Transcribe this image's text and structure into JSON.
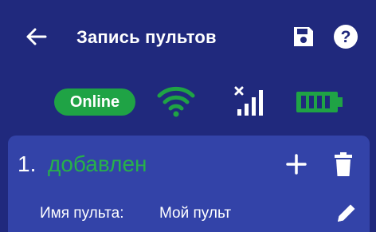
{
  "appbar": {
    "title": "Запись пультов",
    "back_icon": "arrow-left-icon",
    "save_icon": "floppy-disk-icon",
    "help_icon": "question-circle-icon"
  },
  "status": {
    "online_label": "Online",
    "online_color": "#1fa345",
    "wifi_icon": "wifi-icon",
    "wifi_color": "#1fa345",
    "signal_icon": "cellular-no-signal-icon",
    "battery_icon": "battery-full-icon",
    "battery_color": "#1fa345"
  },
  "remote": {
    "index": "1.",
    "status_text": "добавлен",
    "status_color": "#27b14a",
    "name_label": "Имя пульта:",
    "name_value": "Мой пульт",
    "add_icon": "plus-icon",
    "delete_icon": "trash-icon",
    "edit_icon": "pencil-icon"
  },
  "colors": {
    "background": "#20297d",
    "card": "#3343a8"
  }
}
